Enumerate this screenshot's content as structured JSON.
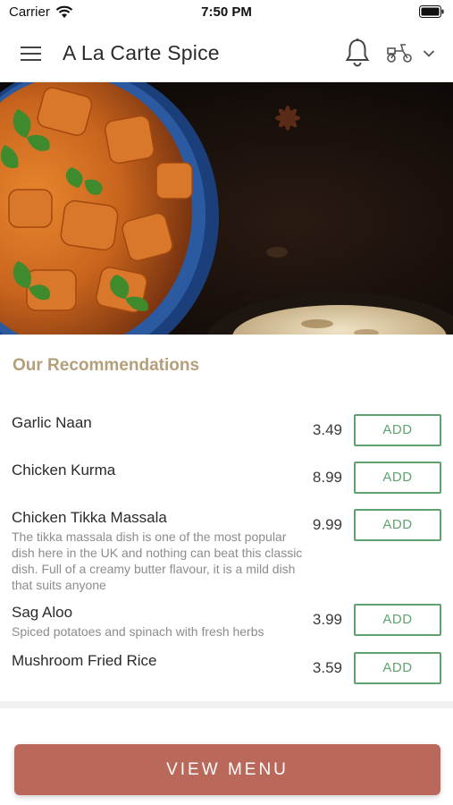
{
  "status_bar": {
    "carrier": "Carrier",
    "time": "7:50 PM"
  },
  "header": {
    "title": "A La Carte Spice",
    "menu_icon": "hamburger-icon",
    "notification_icon": "bell-icon",
    "mode_icon": "scooter-icon",
    "dropdown_icon": "chevron-down-icon"
  },
  "recommendations": {
    "title": "Our Recommendations",
    "add_label": "ADD",
    "items": [
      {
        "name": "Garlic Naan",
        "description": "",
        "price": "3.49"
      },
      {
        "name": "Chicken Kurma",
        "description": "",
        "price": "8.99"
      },
      {
        "name": "Chicken Tikka Massala",
        "description": "The tikka massala dish is one of the most popular dish here in the UK and nothing can beat this classic dish. Full of a creamy butter flavour, it is a mild dish that suits anyone",
        "price": "9.99"
      },
      {
        "name": "Sag Aloo",
        "description": "Spiced potatoes and spinach with fresh herbs",
        "price": "3.99"
      },
      {
        "name": "Mushroom Fried Rice",
        "description": "",
        "price": "3.59"
      }
    ]
  },
  "cta": {
    "label": "VIEW MENU"
  },
  "colors": {
    "accent": "#b9685a",
    "add_green": "#5ea36f",
    "section_title": "#b59f7a"
  }
}
